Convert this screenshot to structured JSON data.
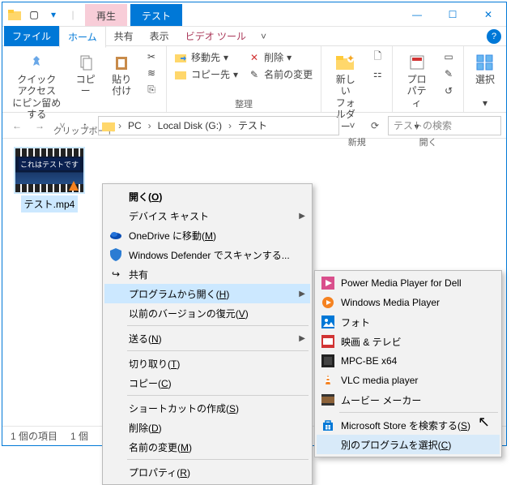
{
  "titlebar": {
    "context_tab": "再生",
    "title_tab": "テスト"
  },
  "ribbon_tabs": {
    "file": "ファイル",
    "home": "ホーム",
    "share": "共有",
    "view": "表示",
    "video": "ビデオ ツール"
  },
  "ribbon": {
    "clipboard": {
      "pin": "クイック アクセス\nにピン留めする",
      "copy": "コピー",
      "paste": "貼り付け",
      "label": "クリップボード"
    },
    "organize": {
      "move_to": "移動先",
      "delete": "削除",
      "copy_to": "コピー先",
      "rename": "名前の変更",
      "label": "整理"
    },
    "new": {
      "new_folder": "新しい\nフォルダー",
      "label": "新規"
    },
    "open": {
      "properties": "プロパティ",
      "label": "開く"
    },
    "select": {
      "select": "選択",
      "label": ""
    }
  },
  "breadcrumb": {
    "pc": "PC",
    "disk": "Local Disk (G:)",
    "folder": "テスト"
  },
  "search": {
    "placeholder": "テストの検索"
  },
  "file": {
    "name": "テスト.mp4",
    "thumb_text": "これはテストです"
  },
  "status": {
    "items": "1 個の項目",
    "selected": "1 個"
  },
  "context_menu": {
    "open": "開く(O)",
    "device_cast": "デバイス キャスト",
    "onedrive": "OneDrive に移動(M)",
    "defender": "Windows Defender でスキャンする...",
    "share": "共有",
    "open_with": "プログラムから開く(H)",
    "restore": "以前のバージョンの復元(V)",
    "send_to": "送る(N)",
    "cut": "切り取り(T)",
    "copy": "コピー(C)",
    "shortcut": "ショートカットの作成(S)",
    "delete": "削除(D)",
    "rename": "名前の変更(M)",
    "properties": "プロパティ(R)"
  },
  "submenu": {
    "power_media": "Power Media Player for Dell",
    "wmp": "Windows Media Player",
    "photos": "フォト",
    "movies_tv": "映画 & テレビ",
    "mpc": "MPC-BE x64",
    "vlc": "VLC media player",
    "movie_maker": "ムービー メーカー",
    "ms_store": "Microsoft Store を検索する(S)",
    "choose": "別のプログラムを選択(C)"
  }
}
